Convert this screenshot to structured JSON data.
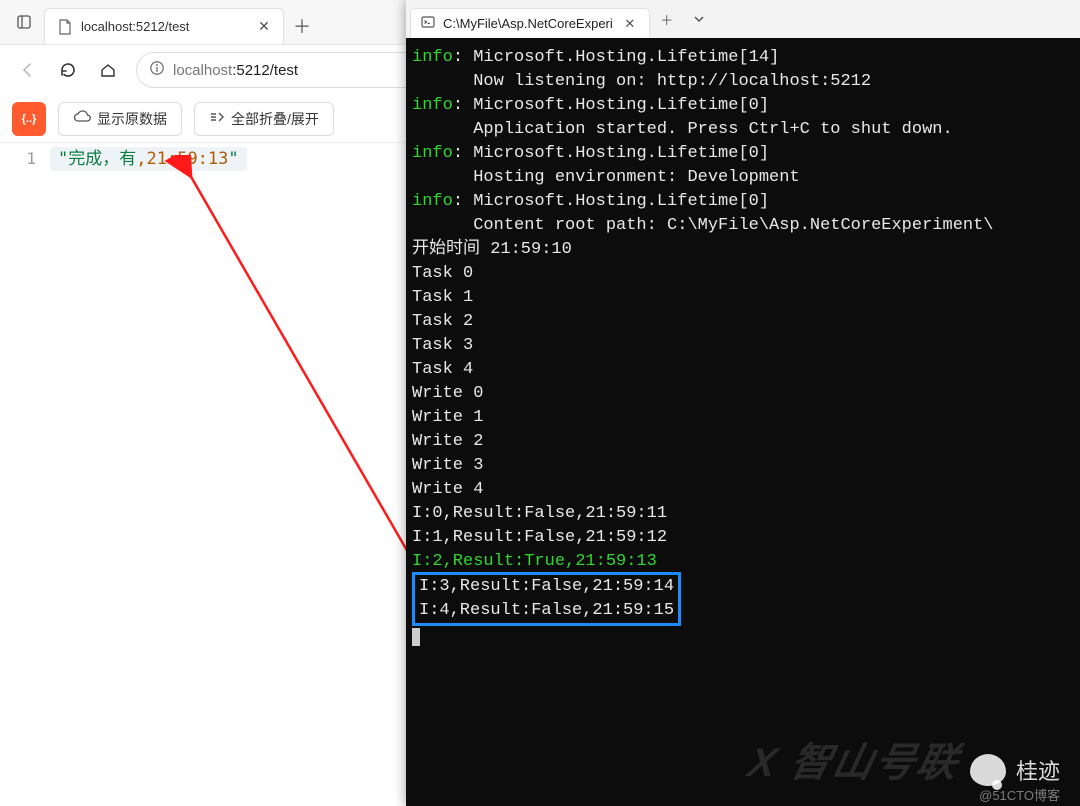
{
  "browser": {
    "tab1": {
      "title": "localhost:5212/test"
    },
    "url_host": "localhost",
    "url_port_path": ":5212/test"
  },
  "toolbar": {
    "show_raw": "显示原数据",
    "fold_all": "全部折叠/展开"
  },
  "code": {
    "line_no": "1",
    "quote1": "\"",
    "zh_prefix": "完成，有",
    "comma": ",",
    "timestamp": "21:59:13",
    "quote2": "\""
  },
  "terminal": {
    "tab_title": "C:\\MyFile\\Asp.NetCoreExperi",
    "lines": [
      {
        "prefix": "info",
        "text": ": Microsoft.Hosting.Lifetime[14]"
      },
      {
        "prefix": "",
        "text": "      Now listening on: http://localhost:5212"
      },
      {
        "prefix": "info",
        "text": ": Microsoft.Hosting.Lifetime[0]"
      },
      {
        "prefix": "",
        "text": "      Application started. Press Ctrl+C to shut down."
      },
      {
        "prefix": "info",
        "text": ": Microsoft.Hosting.Lifetime[0]"
      },
      {
        "prefix": "",
        "text": "      Hosting environment: Development"
      },
      {
        "prefix": "info",
        "text": ": Microsoft.Hosting.Lifetime[0]"
      },
      {
        "prefix": "",
        "text": "      Content root path: C:\\MyFile\\Asp.NetCoreExperiment\\"
      }
    ],
    "start_line": "开始时间 21:59:10",
    "tasks": [
      "Task 0",
      "Task 1",
      "Task 2",
      "Task 3",
      "Task 4"
    ],
    "writes": [
      "Write 0",
      "Write 1",
      "Write 2",
      "Write 3",
      "Write 4"
    ],
    "results": [
      "I:0,Result:False,21:59:11",
      "I:1,Result:False,21:59:12"
    ],
    "result_true": "I:2,Result:True,21:59:13",
    "boxed": [
      "I:3,Result:False,21:59:14",
      "I:4,Result:False,21:59:15"
    ]
  },
  "watermark": {
    "name": "桂迹",
    "sub": "@51CTO博客",
    "faint": "X 智山号联"
  }
}
